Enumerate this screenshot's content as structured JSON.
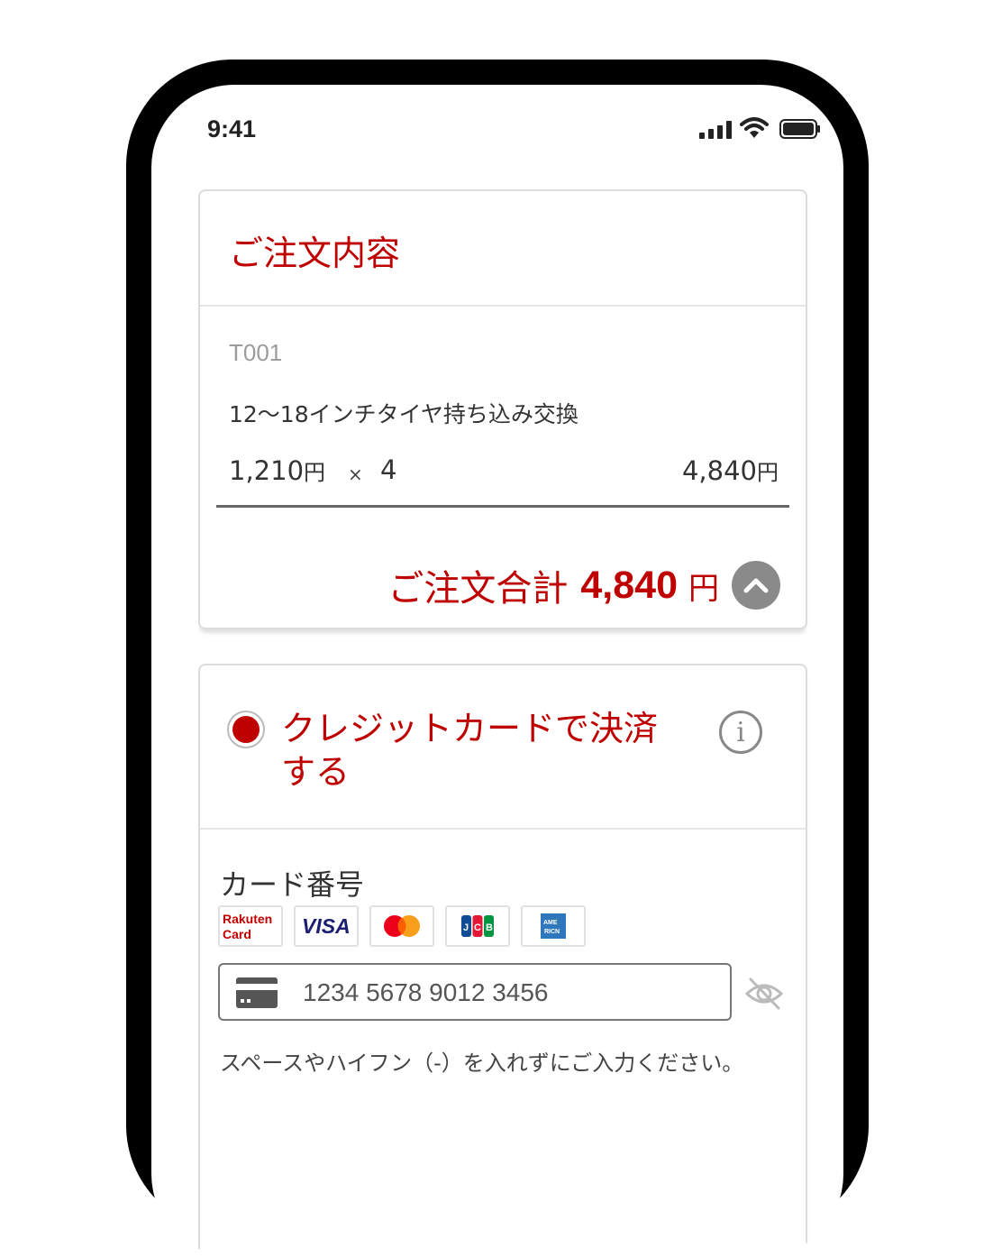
{
  "status_bar": {
    "time": "9:41"
  },
  "order": {
    "title": "ご注文内容",
    "item": {
      "code": "T001",
      "name": "12〜18インチタイヤ持ち込み交換",
      "unit_price": "1,210",
      "yen": "円",
      "multiply": "×",
      "quantity": "4",
      "subtotal": "4,840"
    },
    "total_label": "ご注文合計",
    "total_value": "4,840",
    "total_yen": "円"
  },
  "payment": {
    "method_label": "クレジットカードで決済する",
    "selected": true,
    "card_number_label": "カード番号",
    "brands": [
      "Rakuten Card",
      "VISA",
      "Mastercard",
      "JCB",
      "AMEX"
    ],
    "card_number_placeholder": "1234 5678 9012 3456",
    "help_text": "スペースやハイフン（-）を入れずにご入力ください。"
  },
  "colors": {
    "accent": "#bf0000",
    "toggle": "#8a8a8a"
  },
  "icons": [
    "signal-icon",
    "wifi-icon",
    "battery-icon",
    "chevron-up-icon",
    "info-icon",
    "credit-card-icon",
    "eye-off-icon"
  ]
}
